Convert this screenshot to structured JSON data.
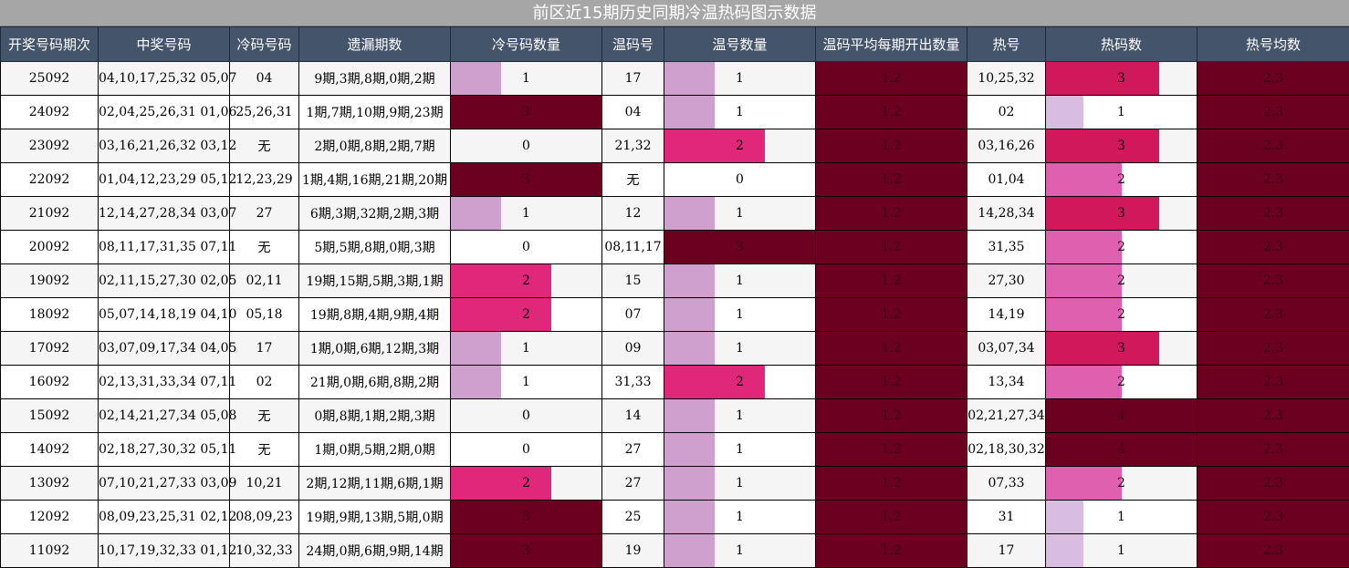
{
  "title": "前区近15期历史同期冷温热码图示数据",
  "columns": [
    "开奖号码期次",
    "中奖号码",
    "冷码号码",
    "遗漏期数",
    "冷号码数量",
    "温码号",
    "温号数量",
    "温码平均每期开出数量",
    "热号",
    "热码数",
    "热号均数"
  ],
  "colors": {
    "header_bg": "#44546a",
    "title_bg": "#a6a6a6",
    "level_1": "#cfa0ce",
    "level_1_light": "#d9bde0",
    "level_2": "#e0287a",
    "level_2_soft": "#e060b0",
    "level_3": "#d0185a",
    "level_full": "#6b0020"
  },
  "rows": [
    {
      "period": "25092",
      "numbers": "04,10,17,25,32 05,07",
      "cold": "04",
      "missing": "9期,3期,8期,0期,2期",
      "cold_count": 1,
      "warm": "17",
      "warm_count": 1,
      "warm_avg": "1.2",
      "hot": "10,25,32",
      "hot_count": 3,
      "hot_avg": "2.3"
    },
    {
      "period": "24092",
      "numbers": "02,04,25,26,31 01,06",
      "cold": "25,26,31",
      "missing": "1期,7期,10期,9期,23期",
      "cold_count": 3,
      "warm": "04",
      "warm_count": 1,
      "warm_avg": "1.2",
      "hot": "02",
      "hot_count": 1,
      "hot_avg": "2.3"
    },
    {
      "period": "23092",
      "numbers": "03,16,21,26,32 03,12",
      "cold": "无",
      "missing": "2期,0期,8期,2期,7期",
      "cold_count": 0,
      "warm": "21,32",
      "warm_count": 2,
      "warm_avg": "1.2",
      "hot": "03,16,26",
      "hot_count": 3,
      "hot_avg": "2.3"
    },
    {
      "period": "22092",
      "numbers": "01,04,12,23,29 05,12",
      "cold": "12,23,29",
      "missing": "1期,4期,16期,21期,20期",
      "cold_count": 3,
      "warm": "无",
      "warm_count": 0,
      "warm_avg": "1.2",
      "hot": "01,04",
      "hot_count": 2,
      "hot_avg": "2.3"
    },
    {
      "period": "21092",
      "numbers": "12,14,27,28,34 03,07",
      "cold": "27",
      "missing": "6期,3期,32期,2期,3期",
      "cold_count": 1,
      "warm": "12",
      "warm_count": 1,
      "warm_avg": "1.2",
      "hot": "14,28,34",
      "hot_count": 3,
      "hot_avg": "2.3"
    },
    {
      "period": "20092",
      "numbers": "08,11,17,31,35 07,11",
      "cold": "无",
      "missing": "5期,5期,8期,0期,3期",
      "cold_count": 0,
      "warm": "08,11,17",
      "warm_count": 3,
      "warm_avg": "1.2",
      "hot": "31,35",
      "hot_count": 2,
      "hot_avg": "2.3"
    },
    {
      "period": "19092",
      "numbers": "02,11,15,27,30 02,05",
      "cold": "02,11",
      "missing": "19期,15期,5期,3期,1期",
      "cold_count": 2,
      "warm": "15",
      "warm_count": 1,
      "warm_avg": "1.2",
      "hot": "27,30",
      "hot_count": 2,
      "hot_avg": "2.3"
    },
    {
      "period": "18092",
      "numbers": "05,07,14,18,19 04,10",
      "cold": "05,18",
      "missing": "19期,8期,4期,9期,4期",
      "cold_count": 2,
      "warm": "07",
      "warm_count": 1,
      "warm_avg": "1.2",
      "hot": "14,19",
      "hot_count": 2,
      "hot_avg": "2.3"
    },
    {
      "period": "17092",
      "numbers": "03,07,09,17,34 04,05",
      "cold": "17",
      "missing": "1期,0期,6期,12期,3期",
      "cold_count": 1,
      "warm": "09",
      "warm_count": 1,
      "warm_avg": "1.2",
      "hot": "03,07,34",
      "hot_count": 3,
      "hot_avg": "2.3"
    },
    {
      "period": "16092",
      "numbers": "02,13,31,33,34 07,11",
      "cold": "02",
      "missing": "21期,0期,6期,8期,2期",
      "cold_count": 1,
      "warm": "31,33",
      "warm_count": 2,
      "warm_avg": "1.2",
      "hot": "13,34",
      "hot_count": 2,
      "hot_avg": "2.3"
    },
    {
      "period": "15092",
      "numbers": "02,14,21,27,34 05,08",
      "cold": "无",
      "missing": "0期,8期,1期,2期,3期",
      "cold_count": 0,
      "warm": "14",
      "warm_count": 1,
      "warm_avg": "1.2",
      "hot": "02,21,27,34",
      "hot_count": 4,
      "hot_avg": "2.3"
    },
    {
      "period": "14092",
      "numbers": "02,18,27,30,32 05,11",
      "cold": "无",
      "missing": "1期,0期,5期,2期,0期",
      "cold_count": 0,
      "warm": "27",
      "warm_count": 1,
      "warm_avg": "1.2",
      "hot": "02,18,30,32",
      "hot_count": 4,
      "hot_avg": "2.3"
    },
    {
      "period": "13092",
      "numbers": "07,10,21,27,33 03,09",
      "cold": "10,21",
      "missing": "2期,12期,11期,6期,1期",
      "cold_count": 2,
      "warm": "27",
      "warm_count": 1,
      "warm_avg": "1.2",
      "hot": "07,33",
      "hot_count": 2,
      "hot_avg": "2.3"
    },
    {
      "period": "12092",
      "numbers": "08,09,23,25,31 02,12",
      "cold": "08,09,23",
      "missing": "19期,9期,13期,5期,0期",
      "cold_count": 3,
      "warm": "25",
      "warm_count": 1,
      "warm_avg": "1.2",
      "hot": "31",
      "hot_count": 1,
      "hot_avg": "2.3"
    },
    {
      "period": "11092",
      "numbers": "10,17,19,32,33 01,12",
      "cold": "10,32,33",
      "missing": "24期,0期,6期,9期,14期",
      "cold_count": 3,
      "warm": "19",
      "warm_count": 1,
      "warm_avg": "1.2",
      "hot": "17",
      "hot_count": 1,
      "hot_avg": "2.3"
    }
  ],
  "chart_data": {
    "type": "table",
    "title": "前区近15期历史同期冷温热码图示数据",
    "categories": [
      "25092",
      "24092",
      "23092",
      "22092",
      "21092",
      "20092",
      "19092",
      "18092",
      "17092",
      "16092",
      "15092",
      "14092",
      "13092",
      "12092",
      "11092"
    ],
    "series": [
      {
        "name": "冷号码数量",
        "values": [
          1,
          3,
          0,
          3,
          1,
          0,
          2,
          2,
          1,
          1,
          0,
          0,
          2,
          3,
          3
        ],
        "max": 3
      },
      {
        "name": "温号数量",
        "values": [
          1,
          1,
          2,
          0,
          1,
          3,
          1,
          1,
          1,
          2,
          1,
          1,
          1,
          1,
          1
        ],
        "max": 3
      },
      {
        "name": "温码平均每期开出数量",
        "values": [
          1.2,
          1.2,
          1.2,
          1.2,
          1.2,
          1.2,
          1.2,
          1.2,
          1.2,
          1.2,
          1.2,
          1.2,
          1.2,
          1.2,
          1.2
        ]
      },
      {
        "name": "热码数",
        "values": [
          3,
          1,
          3,
          2,
          3,
          2,
          2,
          2,
          3,
          2,
          4,
          4,
          2,
          1,
          1
        ],
        "max": 4
      },
      {
        "name": "热号均数",
        "values": [
          2.3,
          2.3,
          2.3,
          2.3,
          2.3,
          2.3,
          2.3,
          2.3,
          2.3,
          2.3,
          2.3,
          2.3,
          2.3,
          2.3,
          2.3
        ]
      }
    ]
  }
}
